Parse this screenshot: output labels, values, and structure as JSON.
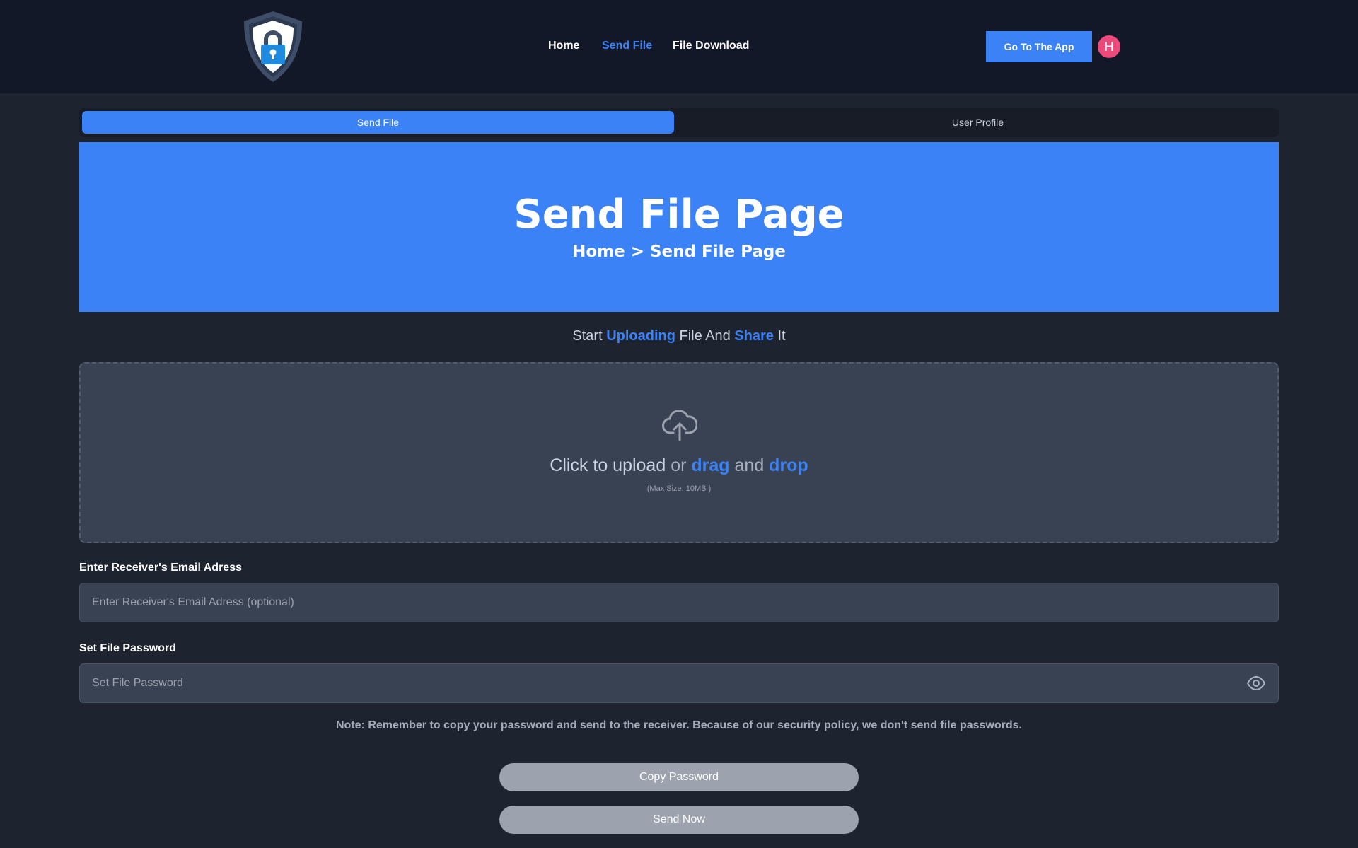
{
  "navbar": {
    "links": [
      {
        "label": "Home"
      },
      {
        "label": "Send File"
      },
      {
        "label": "File Download"
      }
    ],
    "cta_label": "Go To The App",
    "avatar_initial": "H"
  },
  "tabs": [
    {
      "label": "Send File",
      "active": true
    },
    {
      "label": "User Profile",
      "active": false
    }
  ],
  "hero": {
    "title": "Send File Page",
    "breadcrumb": "Home > Send File Page"
  },
  "upload": {
    "heading": {
      "w1": "Start ",
      "w2": "Uploading",
      "w3": " File And ",
      "w4": "Share",
      "w5": " It"
    },
    "drop_text": {
      "w1": "Click to upload",
      "w2": " or ",
      "w3": "drag",
      "w4": " and ",
      "w5": "drop"
    },
    "max_size": "(Max Size: 10MB )"
  },
  "form": {
    "email_label": "Enter Receiver's Email Adress",
    "email_placeholder": "Enter Receiver's Email Adress (optional)",
    "email_value": "",
    "password_label": "Set File Password",
    "password_placeholder": "Set File Password",
    "password_value": ""
  },
  "note": "Note: Remember to copy your password and send to the receiver. Because of our security policy, we don't send file passwords.",
  "buttons": {
    "copy_password": "Copy Password",
    "send_now": "Send Now"
  },
  "colors": {
    "accent": "#3b82f6",
    "navbar_bg": "#121828",
    "page_bg": "#1e2330",
    "avatar_bg": "#ec4a7a",
    "button_disabled": "#9ca3af"
  },
  "icons": {
    "logo": "shield-lock-icon",
    "upload": "cloud-upload-icon",
    "password_toggle": "eye-icon"
  }
}
